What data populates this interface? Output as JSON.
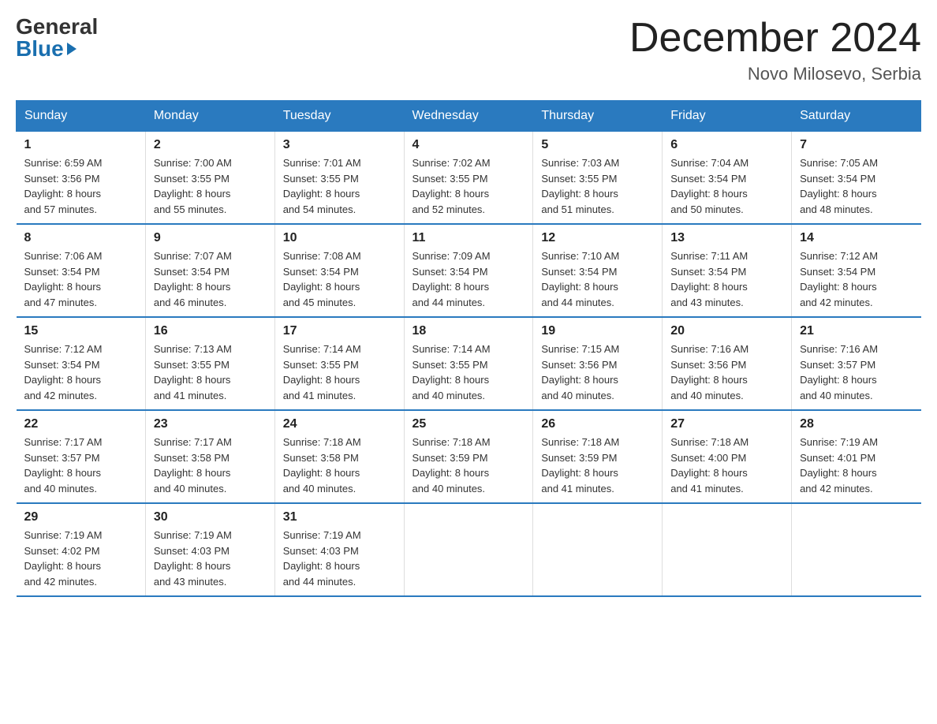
{
  "logo": {
    "general": "General",
    "blue": "Blue"
  },
  "title": "December 2024",
  "location": "Novo Milosevo, Serbia",
  "days_of_week": [
    "Sunday",
    "Monday",
    "Tuesday",
    "Wednesday",
    "Thursday",
    "Friday",
    "Saturday"
  ],
  "weeks": [
    [
      {
        "day": "1",
        "sunrise": "6:59 AM",
        "sunset": "3:56 PM",
        "daylight": "8 hours and 57 minutes."
      },
      {
        "day": "2",
        "sunrise": "7:00 AM",
        "sunset": "3:55 PM",
        "daylight": "8 hours and 55 minutes."
      },
      {
        "day": "3",
        "sunrise": "7:01 AM",
        "sunset": "3:55 PM",
        "daylight": "8 hours and 54 minutes."
      },
      {
        "day": "4",
        "sunrise": "7:02 AM",
        "sunset": "3:55 PM",
        "daylight": "8 hours and 52 minutes."
      },
      {
        "day": "5",
        "sunrise": "7:03 AM",
        "sunset": "3:55 PM",
        "daylight": "8 hours and 51 minutes."
      },
      {
        "day": "6",
        "sunrise": "7:04 AM",
        "sunset": "3:54 PM",
        "daylight": "8 hours and 50 minutes."
      },
      {
        "day": "7",
        "sunrise": "7:05 AM",
        "sunset": "3:54 PM",
        "daylight": "8 hours and 48 minutes."
      }
    ],
    [
      {
        "day": "8",
        "sunrise": "7:06 AM",
        "sunset": "3:54 PM",
        "daylight": "8 hours and 47 minutes."
      },
      {
        "day": "9",
        "sunrise": "7:07 AM",
        "sunset": "3:54 PM",
        "daylight": "8 hours and 46 minutes."
      },
      {
        "day": "10",
        "sunrise": "7:08 AM",
        "sunset": "3:54 PM",
        "daylight": "8 hours and 45 minutes."
      },
      {
        "day": "11",
        "sunrise": "7:09 AM",
        "sunset": "3:54 PM",
        "daylight": "8 hours and 44 minutes."
      },
      {
        "day": "12",
        "sunrise": "7:10 AM",
        "sunset": "3:54 PM",
        "daylight": "8 hours and 44 minutes."
      },
      {
        "day": "13",
        "sunrise": "7:11 AM",
        "sunset": "3:54 PM",
        "daylight": "8 hours and 43 minutes."
      },
      {
        "day": "14",
        "sunrise": "7:12 AM",
        "sunset": "3:54 PM",
        "daylight": "8 hours and 42 minutes."
      }
    ],
    [
      {
        "day": "15",
        "sunrise": "7:12 AM",
        "sunset": "3:54 PM",
        "daylight": "8 hours and 42 minutes."
      },
      {
        "day": "16",
        "sunrise": "7:13 AM",
        "sunset": "3:55 PM",
        "daylight": "8 hours and 41 minutes."
      },
      {
        "day": "17",
        "sunrise": "7:14 AM",
        "sunset": "3:55 PM",
        "daylight": "8 hours and 41 minutes."
      },
      {
        "day": "18",
        "sunrise": "7:14 AM",
        "sunset": "3:55 PM",
        "daylight": "8 hours and 40 minutes."
      },
      {
        "day": "19",
        "sunrise": "7:15 AM",
        "sunset": "3:56 PM",
        "daylight": "8 hours and 40 minutes."
      },
      {
        "day": "20",
        "sunrise": "7:16 AM",
        "sunset": "3:56 PM",
        "daylight": "8 hours and 40 minutes."
      },
      {
        "day": "21",
        "sunrise": "7:16 AM",
        "sunset": "3:57 PM",
        "daylight": "8 hours and 40 minutes."
      }
    ],
    [
      {
        "day": "22",
        "sunrise": "7:17 AM",
        "sunset": "3:57 PM",
        "daylight": "8 hours and 40 minutes."
      },
      {
        "day": "23",
        "sunrise": "7:17 AM",
        "sunset": "3:58 PM",
        "daylight": "8 hours and 40 minutes."
      },
      {
        "day": "24",
        "sunrise": "7:18 AM",
        "sunset": "3:58 PM",
        "daylight": "8 hours and 40 minutes."
      },
      {
        "day": "25",
        "sunrise": "7:18 AM",
        "sunset": "3:59 PM",
        "daylight": "8 hours and 40 minutes."
      },
      {
        "day": "26",
        "sunrise": "7:18 AM",
        "sunset": "3:59 PM",
        "daylight": "8 hours and 41 minutes."
      },
      {
        "day": "27",
        "sunrise": "7:18 AM",
        "sunset": "4:00 PM",
        "daylight": "8 hours and 41 minutes."
      },
      {
        "day": "28",
        "sunrise": "7:19 AM",
        "sunset": "4:01 PM",
        "daylight": "8 hours and 42 minutes."
      }
    ],
    [
      {
        "day": "29",
        "sunrise": "7:19 AM",
        "sunset": "4:02 PM",
        "daylight": "8 hours and 42 minutes."
      },
      {
        "day": "30",
        "sunrise": "7:19 AM",
        "sunset": "4:03 PM",
        "daylight": "8 hours and 43 minutes."
      },
      {
        "day": "31",
        "sunrise": "7:19 AM",
        "sunset": "4:03 PM",
        "daylight": "8 hours and 44 minutes."
      },
      null,
      null,
      null,
      null
    ]
  ],
  "labels": {
    "sunrise": "Sunrise:",
    "sunset": "Sunset:",
    "daylight": "Daylight:"
  }
}
